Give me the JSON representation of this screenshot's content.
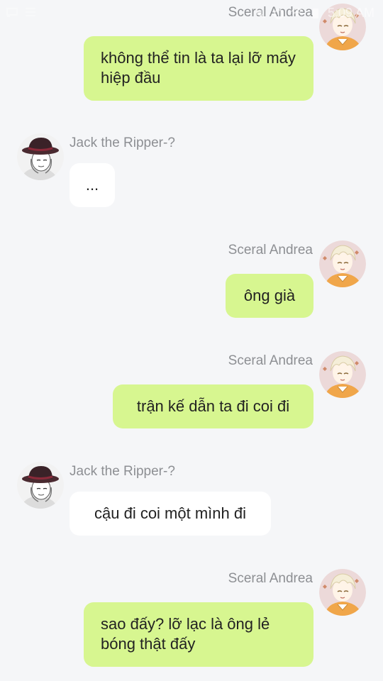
{
  "status_bar": {
    "time": "5:09 AM"
  },
  "colors": {
    "background": "#f5f6f8",
    "my_bubble": "#d7f690",
    "their_bubble": "#ffffff",
    "sender_name": "#8d8f93"
  },
  "messages": [
    {
      "sender": "Sceral Andrea",
      "side": "right",
      "text": "không thể tin là ta lại lỡ mấy hiệp đầu"
    },
    {
      "sender": "Jack the Ripper-?",
      "side": "left",
      "text": "..."
    },
    {
      "sender": "Sceral Andrea",
      "side": "right",
      "text": "ông già"
    },
    {
      "sender": "Sceral Andrea",
      "side": "right",
      "text": "trận kế dẫn ta đi coi đi"
    },
    {
      "sender": "Jack the Ripper-?",
      "side": "left",
      "text": "cậu đi coi một mình đi"
    },
    {
      "sender": "Sceral Andrea",
      "side": "right",
      "text": "sao đấy? lỡ lạc là ông lẻ bóng thật đấy"
    }
  ]
}
